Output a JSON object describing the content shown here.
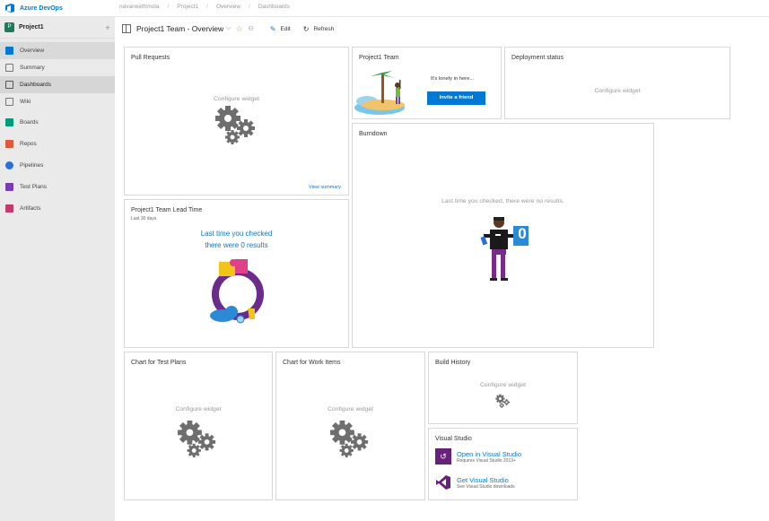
{
  "topbar": {
    "brand": "Azure DevOps",
    "breadcrumb": [
      "navaneethmola",
      "Project1",
      "Overview",
      "Dashboards"
    ],
    "brand_color": "#0078d4"
  },
  "sidebar": {
    "project": {
      "badge": "P",
      "name": "Project1",
      "add": "+"
    },
    "items": [
      {
        "label": "Overview",
        "icon": "overview-icon",
        "color": "#0078d4"
      },
      {
        "label": "Summary",
        "icon": "summary-icon",
        "color": "#777777"
      },
      {
        "label": "Dashboards",
        "icon": "dashboards-icon",
        "color": "#777777"
      },
      {
        "label": "Wiki",
        "icon": "wiki-icon",
        "color": "#777777"
      },
      {
        "label": "Boards",
        "icon": "boards-icon",
        "color": "#009c7a"
      },
      {
        "label": "Repos",
        "icon": "repos-icon",
        "color": "#e05a3a"
      },
      {
        "label": "Pipelines",
        "icon": "pipelines-icon",
        "color": "#2b6fd6"
      },
      {
        "label": "Test Plans",
        "icon": "test-plans-icon",
        "color": "#7a3bb6"
      },
      {
        "label": "Artifacts",
        "icon": "artifacts-icon",
        "color": "#c43a6d"
      }
    ]
  },
  "header": {
    "title": "Project1 Team - Overview",
    "chevron": "⌵",
    "edit": "Edit",
    "refresh": "Refresh"
  },
  "widgets": {
    "pull_requests": {
      "title": "Pull Requests",
      "configure": "Configure widget",
      "link": "View summary"
    },
    "team": {
      "title": "Project1 Team",
      "message": "It's lonely in here...",
      "button": "Invite a friend"
    },
    "deployment": {
      "title": "Deployment status",
      "configure": "Configure widget"
    },
    "burndown": {
      "title": "Burndown",
      "message": "Last time you checked, there were no results.",
      "count": "0"
    },
    "lead_time": {
      "title": "Project1 Team Lead Time",
      "subtitle": "Last 30 days",
      "line1": "Last time you checked",
      "line2": "there were 0 results"
    },
    "test_plans": {
      "title": "Chart for Test Plans",
      "configure": "Configure widget"
    },
    "work_items": {
      "title": "Chart for Work Items",
      "configure": "Configure widget"
    },
    "build_history": {
      "title": "Build History",
      "configure": "Configure widget"
    },
    "visual_studio": {
      "title": "Visual Studio",
      "open": "Open in Visual Studio",
      "open_sub": "Requires Visual Studio 2013+",
      "get": "Get Visual Studio",
      "get_sub": "See Visual Studio downloads"
    }
  }
}
